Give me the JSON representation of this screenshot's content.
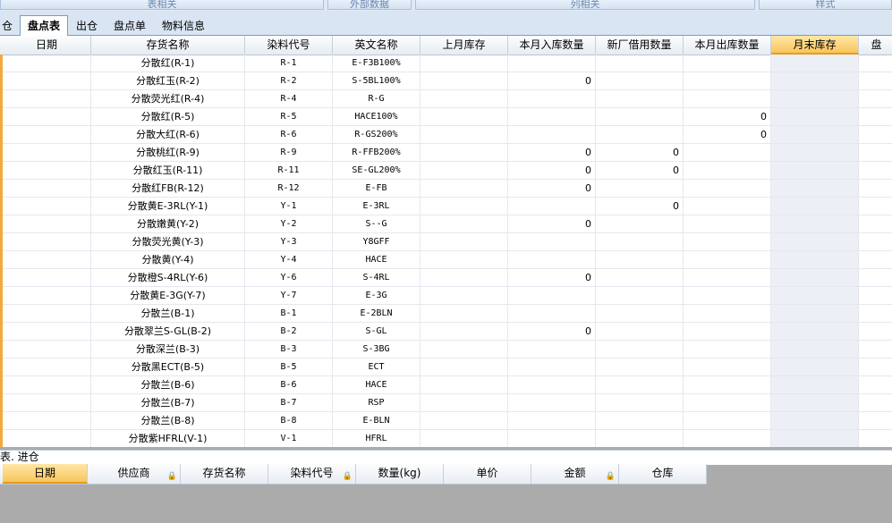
{
  "ribbon": {
    "groups": [
      "表相关",
      "外部数据",
      "列相关",
      "样式"
    ]
  },
  "tabs": [
    "仓",
    "盘点表",
    "出仓",
    "盘点单",
    "物料信息"
  ],
  "active_tab": 1,
  "grid": {
    "columns": [
      "日期",
      "存货名称",
      "染料代号",
      "英文名称",
      "上月库存",
      "本月入库数量",
      "新厂借用数量",
      "本月出库数量",
      "月末库存",
      "盘"
    ],
    "rows": [
      {
        "name": "分散红(R-1)",
        "code": "R-1",
        "en": "E-F3B100%",
        "in": "",
        "borrow": "",
        "out": ""
      },
      {
        "name": "分散红玉(R-2)",
        "code": "R-2",
        "en": "S-5BL100%",
        "in": "0",
        "borrow": "",
        "out": ""
      },
      {
        "name": "分散荧光红(R-4)",
        "code": "R-4",
        "en": "R-G",
        "in": "",
        "borrow": "",
        "out": ""
      },
      {
        "name": "分散红(R-5)",
        "code": "R-5",
        "en": "HACE100%",
        "in": "",
        "borrow": "",
        "out": "0"
      },
      {
        "name": "分散大红(R-6)",
        "code": "R-6",
        "en": "R-GS200%",
        "in": "",
        "borrow": "",
        "out": "0"
      },
      {
        "name": "分散桃红(R-9)",
        "code": "R-9",
        "en": "R-FFB200%",
        "in": "0",
        "borrow": "0",
        "out": ""
      },
      {
        "name": "分散红玉(R-11)",
        "code": "R-11",
        "en": "SE-GL200%",
        "in": "0",
        "borrow": "0",
        "out": ""
      },
      {
        "name": "分散红FB(R-12)",
        "code": "R-12",
        "en": "E-FB",
        "in": "0",
        "borrow": "",
        "out": ""
      },
      {
        "name": "分散黄E-3RL(Y-1)",
        "code": "Y-1",
        "en": "E-3RL",
        "in": "",
        "borrow": "0",
        "out": ""
      },
      {
        "name": "分散嫩黄(Y-2)",
        "code": "Y-2",
        "en": "S--G",
        "in": "0",
        "borrow": "",
        "out": ""
      },
      {
        "name": "分散荧光黄(Y-3)",
        "code": "Y-3",
        "en": "Y8GFF",
        "in": "",
        "borrow": "",
        "out": ""
      },
      {
        "name": "分散黄(Y-4)",
        "code": "Y-4",
        "en": "HACE",
        "in": "",
        "borrow": "",
        "out": ""
      },
      {
        "name": "分散橙S-4RL(Y-6)",
        "code": "Y-6",
        "en": "S-4RL",
        "in": "0",
        "borrow": "",
        "out": ""
      },
      {
        "name": "分散黄E-3G(Y-7)",
        "code": "Y-7",
        "en": "E-3G",
        "in": "",
        "borrow": "",
        "out": ""
      },
      {
        "name": "分散兰(B-1)",
        "code": "B-1",
        "en": "E-2BLN",
        "in": "",
        "borrow": "",
        "out": ""
      },
      {
        "name": "分散翠兰S-GL(B-2)",
        "code": "B-2",
        "en": "S-GL",
        "in": "0",
        "borrow": "",
        "out": ""
      },
      {
        "name": "分散深兰(B-3)",
        "code": "B-3",
        "en": "S-3BG",
        "in": "",
        "borrow": "",
        "out": ""
      },
      {
        "name": "分散黑ECT(B-5)",
        "code": "B-5",
        "en": "ECT",
        "in": "",
        "borrow": "",
        "out": ""
      },
      {
        "name": "分散兰(B-6)",
        "code": "B-6",
        "en": "HACE",
        "in": "",
        "borrow": "",
        "out": ""
      },
      {
        "name": "分散兰(B-7)",
        "code": "B-7",
        "en": "RSP",
        "in": "",
        "borrow": "",
        "out": ""
      },
      {
        "name": "分散兰(B-8)",
        "code": "B-8",
        "en": "E-BLN",
        "in": "",
        "borrow": "",
        "out": ""
      },
      {
        "name": "分散紫HFRL(V-1)",
        "code": "V-1",
        "en": "HFRL",
        "in": "",
        "borrow": "",
        "out": ""
      }
    ]
  },
  "status": {
    "text": "表. 进仓"
  },
  "subgrid": {
    "columns": [
      "日期",
      "供应商",
      "存货名称",
      "染料代号",
      "数量(kg)",
      "单价",
      "金额",
      "仓库"
    ]
  }
}
